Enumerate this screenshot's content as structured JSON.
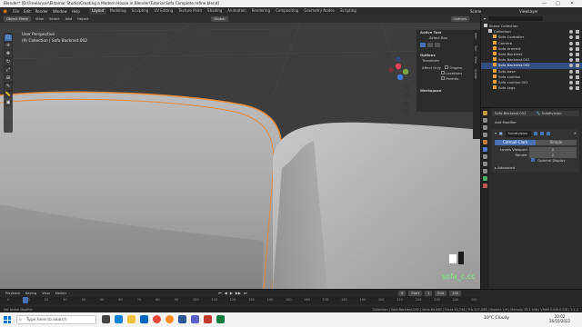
{
  "titlebar": {
    "title": "Blender* [D:\\Freelancer\\Eldamar Studio\\Creating a Modern House in Blender\\Tutorial Sofa Complete refine.blend]",
    "minimize": "—",
    "maximize": "□",
    "close": "✕"
  },
  "menubar": {
    "menus": [
      "File",
      "Edit",
      "Render",
      "Window",
      "Help"
    ],
    "workspaces": [
      "Layout",
      "Modeling",
      "Sculpting",
      "UV Editing",
      "Texture Paint",
      "Shading",
      "Animation",
      "Rendering",
      "Compositing",
      "Geometry Nodes",
      "Scripting"
    ],
    "active_workspace": "Layout",
    "scene": "Scene",
    "view_layer": "ViewLayer"
  },
  "viewport_header": {
    "mode": "Object Mode",
    "menus": [
      "View",
      "Select",
      "Add",
      "Object"
    ],
    "transform_orientation": "Global",
    "options": "Options"
  },
  "viewport": {
    "view_name": "User Perspective",
    "collection_info": "(9) Collection | Sofa Backrest.002",
    "stats_text": "sofa_c.cc",
    "accent_color": "#e58a3a"
  },
  "toolbar": {
    "tools": [
      "select-icon",
      "cursor-icon",
      "move-icon",
      "rotate-icon",
      "scale-icon",
      "transform-icon",
      "annotate-icon",
      "measure-icon",
      "add-cube-icon"
    ]
  },
  "sidebar": {
    "active_tool": "Active Tool",
    "select_box": "Select Box",
    "options": "Options",
    "transform": "Transform",
    "affect_only": "Affect Only",
    "origins": "Origins",
    "locations": "Locations",
    "parents": "Parents",
    "workspace": "Workspace",
    "tabs": [
      "Item",
      "Tool",
      "View",
      "Create"
    ]
  },
  "outliner": {
    "search_placeholder": "",
    "items": [
      {
        "label": "Scene Collection",
        "indent": 0,
        "selected": false
      },
      {
        "label": "Collection",
        "indent": 1,
        "selected": false
      },
      {
        "label": "Sofa Controller",
        "indent": 2,
        "selected": false
      },
      {
        "label": "Camera",
        "indent": 2,
        "selected": false
      },
      {
        "label": "Sofa Armrest",
        "indent": 2,
        "selected": false
      },
      {
        "label": "Sofa Backrest",
        "indent": 2,
        "selected": false
      },
      {
        "label": "Sofa Backrest.001",
        "indent": 2,
        "selected": false
      },
      {
        "label": "Sofa Backrest.002",
        "indent": 2,
        "selected": true
      },
      {
        "label": "Sofa base",
        "indent": 2,
        "selected": false
      },
      {
        "label": "Sofa cushion",
        "indent": 2,
        "selected": false
      },
      {
        "label": "Sofa cushion.001",
        "indent": 2,
        "selected": false
      },
      {
        "label": "Sofa Legs",
        "indent": 2,
        "selected": false
      }
    ]
  },
  "properties": {
    "object_name": "Sofa Backrest.002",
    "modifier_type": "Subdivision",
    "add_modifier": "Add Modifier",
    "modifier_name": "Subdivision",
    "tab_catmull": "Catmull-Clark",
    "tab_simple": "Simple",
    "levels_viewport_label": "Levels Viewport",
    "levels_viewport_value": "2",
    "render_label": "Render",
    "render_value": "2",
    "optimal_display": "Optimal Display",
    "advanced": "Advanced"
  },
  "timeline": {
    "menus": [
      "Playback",
      "Keying",
      "View",
      "Marker"
    ],
    "current_frame": "9",
    "start_label": "Start",
    "start_value": "1",
    "end_label": "End",
    "end_value": "250",
    "ticks": [
      "0",
      "10",
      "20",
      "30",
      "40",
      "50",
      "60",
      "70",
      "80",
      "90",
      "100",
      "110",
      "120",
      "130",
      "140",
      "150",
      "160",
      "170",
      "180",
      "190",
      "200",
      "210",
      "220",
      "230",
      "240",
      "250"
    ]
  },
  "statusbar": {
    "left": "Set Active Modifier",
    "right": "Collection | Sofa Backrest.002 | Verts 64,480 | Faces 63,744 | Tris 127,488 | Objects 1/9 | Memory 33.1 MiB | VRAM 0.6/6.0 GiB | 3.1.2"
  },
  "taskbar": {
    "search_placeholder": "Type here to search",
    "weather": "10°C  Cloudy",
    "time": "20:02",
    "date": "26/10/2022"
  }
}
